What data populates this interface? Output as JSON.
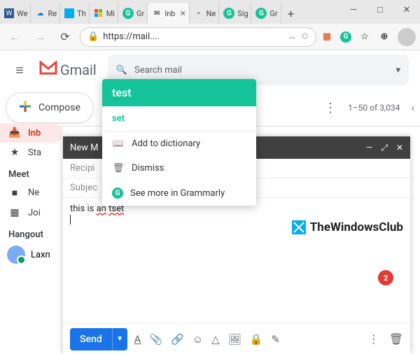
{
  "browser": {
    "tabs": [
      {
        "title": "We",
        "favicon": "word"
      },
      {
        "title": "Re",
        "favicon": "onedrive"
      },
      {
        "title": "Th",
        "favicon": "twc"
      },
      {
        "title": "Mi",
        "favicon": "ms"
      },
      {
        "title": "Gr",
        "favicon": "grammarly"
      },
      {
        "title": "Inb",
        "favicon": "gmail",
        "active": true
      },
      {
        "title": "Ne",
        "favicon": "page"
      },
      {
        "title": "Sig",
        "favicon": "grammarly"
      },
      {
        "title": "Gr",
        "favicon": "grammarly"
      }
    ],
    "url": "https://mail....",
    "newtab": "+"
  },
  "win": {
    "min": "—",
    "max": "□",
    "close": "✕"
  },
  "gmail": {
    "brand": "Gmail",
    "search_placeholder": "Search mail",
    "compose": "Compose",
    "count": "1–50 of 3,034",
    "sidebar": [
      {
        "icon": "inbox",
        "label": "Inb",
        "active": true
      },
      {
        "icon": "star",
        "label": "Sta"
      }
    ],
    "meet_header": "Meet",
    "meet_items": [
      {
        "icon": "video",
        "label": "Ne"
      },
      {
        "icon": "join",
        "label": "Joi"
      }
    ],
    "hangouts_header": "Hangout",
    "hangouts_user": "Laxn"
  },
  "compose_panel": {
    "title": "New M",
    "recipients_label": "Recipi",
    "subject_label": "Subjec",
    "body_text": "this is ",
    "body_err1": "an",
    "body_err2": "tset",
    "send": "Send",
    "badge": "2"
  },
  "watermark": {
    "text": "TheWindowsClub"
  },
  "grammarly": {
    "word": "test",
    "suggestion": "set",
    "add": "Add to dictionary",
    "dismiss": "Dismiss",
    "more": "See more in Grammarly"
  },
  "colors": {
    "grammarly": "#15c39a",
    "gmail_blue": "#1a73e8",
    "danger": "#d93025"
  }
}
